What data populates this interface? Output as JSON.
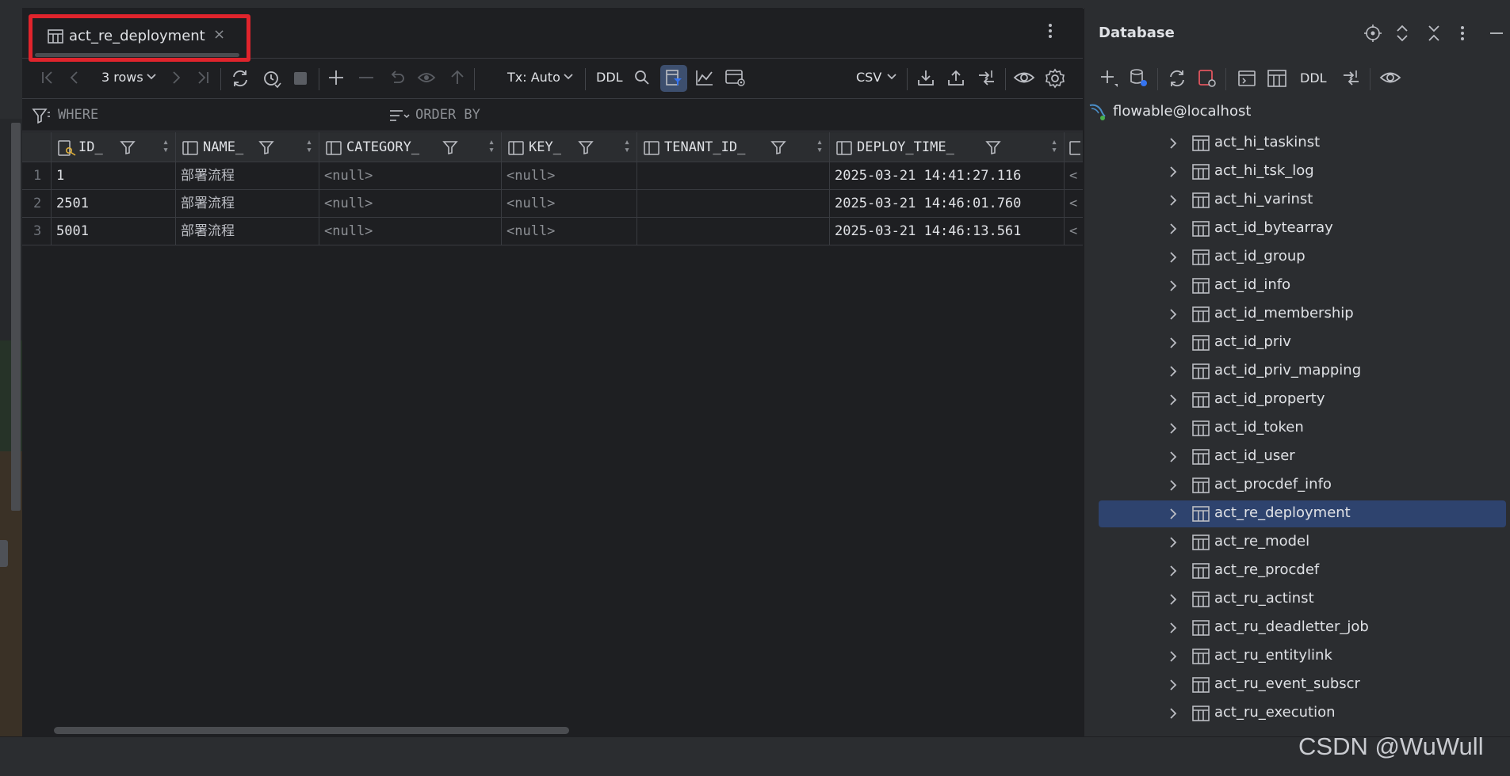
{
  "tab": {
    "label": "act_re_deployment",
    "close_glyph": "×"
  },
  "toolbar": {
    "rows_label": "3 rows",
    "tx_label": "Tx: Auto",
    "ddl_label": "DDL",
    "export_format": "CSV"
  },
  "filter": {
    "where_label": "WHERE",
    "order_label": "ORDER BY"
  },
  "columns": [
    "ID_",
    "NAME_",
    "CATEGORY_",
    "KEY_",
    "TENANT_ID_",
    "DEPLOY_TIME_"
  ],
  "rows": [
    {
      "num": "1",
      "id": "1",
      "name": "部署流程",
      "category": "<null>",
      "key": "<null>",
      "tenant": "",
      "time": "2025-03-21 14:41:27.116",
      "next": "<"
    },
    {
      "num": "2",
      "id": "2501",
      "name": "部署流程",
      "category": "<null>",
      "key": "<null>",
      "tenant": "",
      "time": "2025-03-21 14:46:01.760",
      "next": "<"
    },
    {
      "num": "3",
      "id": "5001",
      "name": "部署流程",
      "category": "<null>",
      "key": "<null>",
      "tenant": "",
      "time": "2025-03-21 14:46:13.561",
      "next": "<"
    }
  ],
  "db_panel": {
    "title": "Database",
    "ddl_label": "DDL",
    "connection": "flowable@localhost",
    "tables": [
      "act_hi_taskinst",
      "act_hi_tsk_log",
      "act_hi_varinst",
      "act_id_bytearray",
      "act_id_group",
      "act_id_info",
      "act_id_membership",
      "act_id_priv",
      "act_id_priv_mapping",
      "act_id_property",
      "act_id_token",
      "act_id_user",
      "act_procdef_info",
      "act_re_deployment",
      "act_re_model",
      "act_re_procdef",
      "act_ru_actinst",
      "act_ru_deadletter_job",
      "act_ru_entitylink",
      "act_ru_event_subscr",
      "act_ru_execution"
    ],
    "selected": "act_re_deployment"
  },
  "watermark": "CSDN @WuWull",
  "colors": {
    "accent": "#3574f0",
    "selection": "#2e436e",
    "highlight_border": "#e0242c"
  }
}
